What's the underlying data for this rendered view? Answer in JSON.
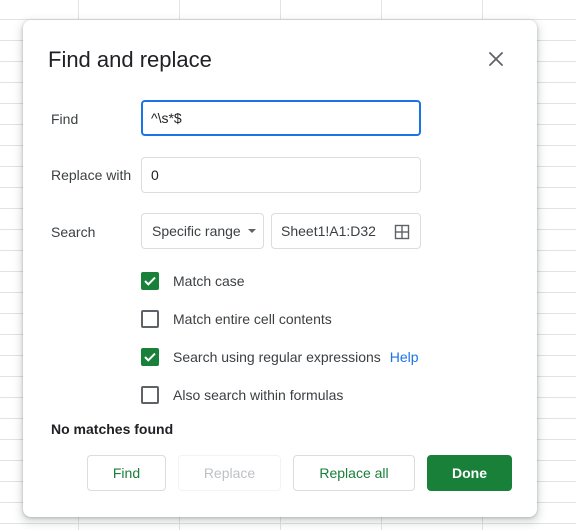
{
  "dialog": {
    "title": "Find and replace",
    "close_icon": "close-icon"
  },
  "find": {
    "label": "Find",
    "value": "^\\s*$"
  },
  "replace_with": {
    "label": "Replace with",
    "value": "0"
  },
  "search": {
    "label": "Search",
    "scope_selected": "Specific range",
    "range_value": "Sheet1!A1:D32",
    "range_icon": "grid-select-icon"
  },
  "options": {
    "match_case": {
      "label": "Match case",
      "checked": true
    },
    "match_entire": {
      "label": "Match entire cell contents",
      "checked": false
    },
    "regex": {
      "label": "Search using regular expressions",
      "checked": true,
      "help_label": "Help"
    },
    "formulas": {
      "label": "Also search within formulas",
      "checked": false
    }
  },
  "status": "No matches found",
  "buttons": {
    "find": "Find",
    "replace": "Replace",
    "replace_all": "Replace all",
    "done": "Done"
  },
  "colors": {
    "accent_green": "#188038",
    "focus_blue": "#1a73e8",
    "link_blue": "#1a73e8"
  }
}
